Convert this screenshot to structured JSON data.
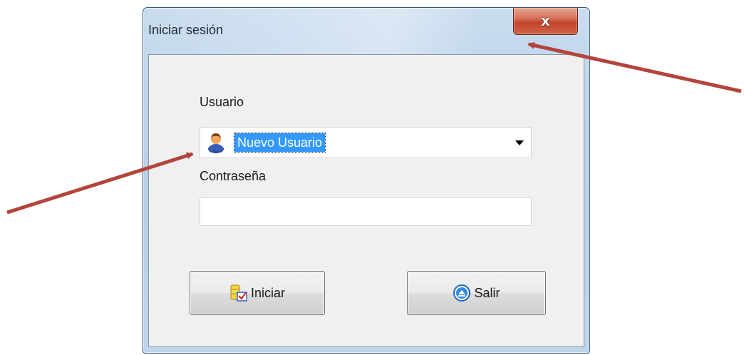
{
  "window": {
    "title": "Iniciar sesión",
    "close_glyph": "x"
  },
  "form": {
    "user_label": "Usuario",
    "user_selected": "Nuevo Usuario",
    "password_label": "Contraseña",
    "password_value": ""
  },
  "buttons": {
    "login_label": "Iniciar",
    "exit_label": "Salir"
  },
  "icons": {
    "user": "user-icon",
    "login": "login-icon",
    "exit": "exit-icon",
    "dropdown": "chevron-down-icon"
  },
  "colors": {
    "selection": "#3399ff",
    "annotation_arrow": "#b3443c",
    "close_button": "#c2452a"
  }
}
